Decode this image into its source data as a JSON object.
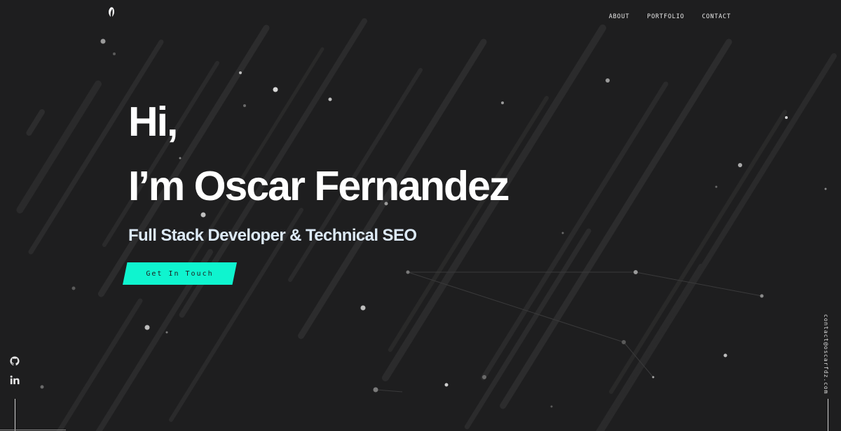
{
  "header": {
    "logo_icon": "leaf-logo-icon",
    "nav": [
      {
        "label": "ABOUT"
      },
      {
        "label": "PORTFOLIO"
      },
      {
        "label": "CONTACT"
      }
    ]
  },
  "hero": {
    "greeting": "Hi,",
    "name_line": "I’m Oscar Fernandez",
    "subtitle": "Full Stack Developer & Technical SEO",
    "cta_label": "Get In Touch"
  },
  "sidebar_left": {
    "icons": [
      "github-icon",
      "linkedin-icon"
    ]
  },
  "sidebar_right": {
    "email": "contact@oscarfdz.com"
  },
  "colors": {
    "background": "#1e1e1f",
    "accent": "#0ff4cf",
    "text": "#ffffff",
    "subtitle": "#dce9f5"
  }
}
